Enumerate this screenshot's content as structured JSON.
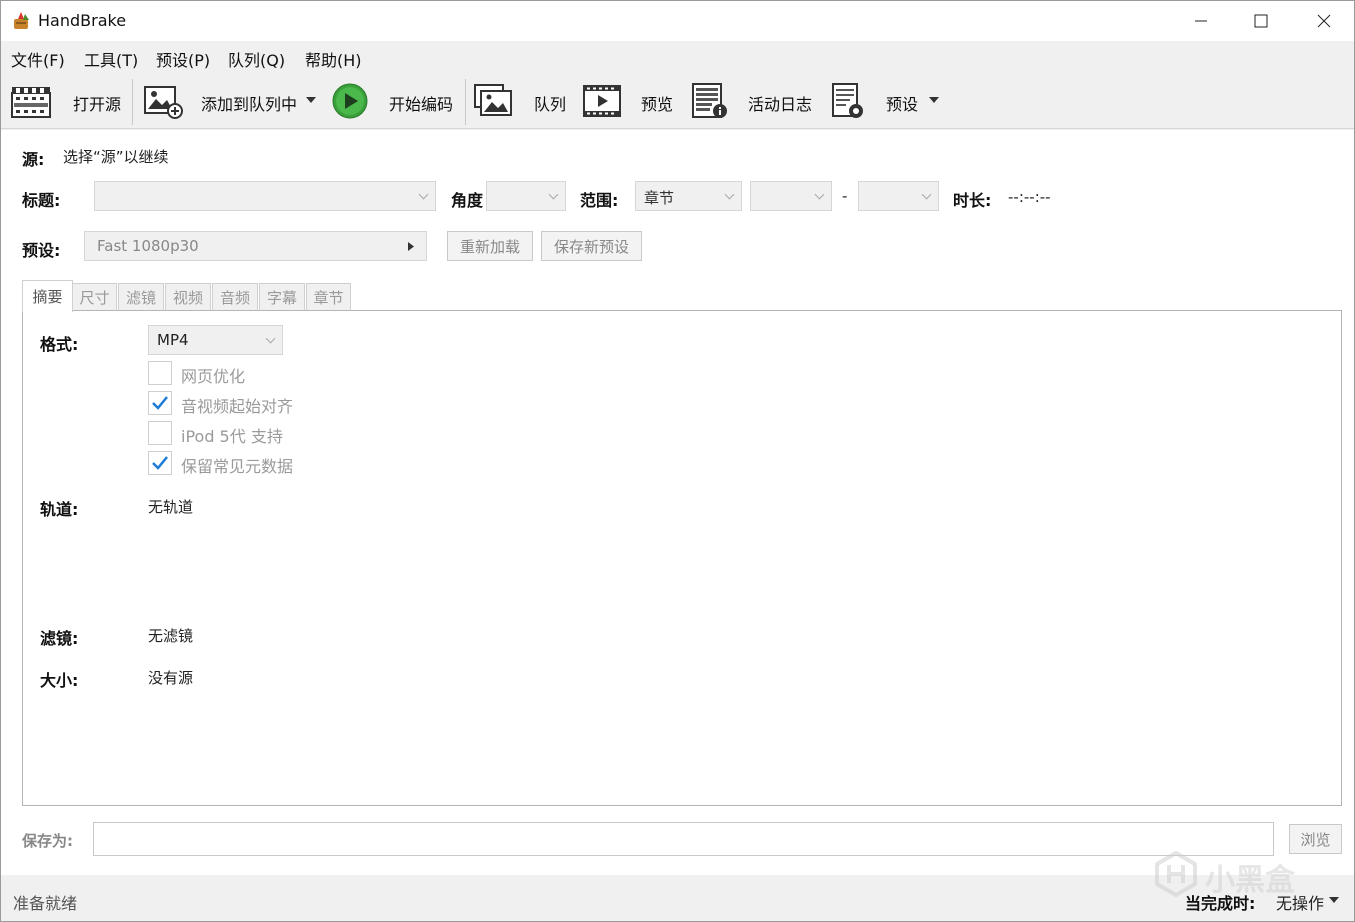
{
  "window": {
    "title": "HandBrake",
    "controls": {
      "minimize": "minimize",
      "maximize": "maximize",
      "close": "close"
    }
  },
  "menu": [
    "文件(F)",
    "工具(T)",
    "预设(P)",
    "队列(Q)",
    "帮助(H)"
  ],
  "toolbar": {
    "open_source": "打开源",
    "add_to_queue": "添加到队列中",
    "start_encode": "开始编码",
    "queue": "队列",
    "preview": "预览",
    "activity_log": "活动日志",
    "presets": "预设"
  },
  "source": {
    "label": "源:",
    "value": "选择“源”以继续"
  },
  "title_row": {
    "title_label": "标题:",
    "title_value": "",
    "angle_label": "角度",
    "angle_value": "",
    "range_label": "范围:",
    "range_value": "章节",
    "range_start": "",
    "range_sep": "-",
    "range_end": "",
    "duration_label": "时长:",
    "duration_value": "--:--:--"
  },
  "preset_row": {
    "label": "预设:",
    "value": "Fast 1080p30",
    "reload_button": "重新加载",
    "save_new_button": "保存新预设"
  },
  "tabs": [
    "摘要",
    "尺寸",
    "滤镜",
    "视频",
    "音频",
    "字幕",
    "章节"
  ],
  "active_tab": "摘要",
  "summary": {
    "format_label": "格式:",
    "format_value": "MP4",
    "options": [
      {
        "label": "网页优化",
        "checked": false
      },
      {
        "label": "音视频起始对齐",
        "checked": true
      },
      {
        "label": "iPod 5代 支持",
        "checked": false
      },
      {
        "label": "保留常见元数据",
        "checked": true
      }
    ],
    "tracks_label": "轨道:",
    "tracks_value": "无轨道",
    "filters_label": "滤镜:",
    "filters_value": "无滤镜",
    "size_label": "大小:",
    "size_value": "没有源"
  },
  "save": {
    "label": "保存为:",
    "value": "",
    "browse_button": "浏览"
  },
  "status": {
    "text": "准备就绪",
    "when_done_label": "当完成时:",
    "when_done_value": "无操作"
  },
  "watermark": "小黑盒",
  "colors": {
    "accent_check": "#1e7bd6",
    "play_green": "#3aa03a"
  }
}
